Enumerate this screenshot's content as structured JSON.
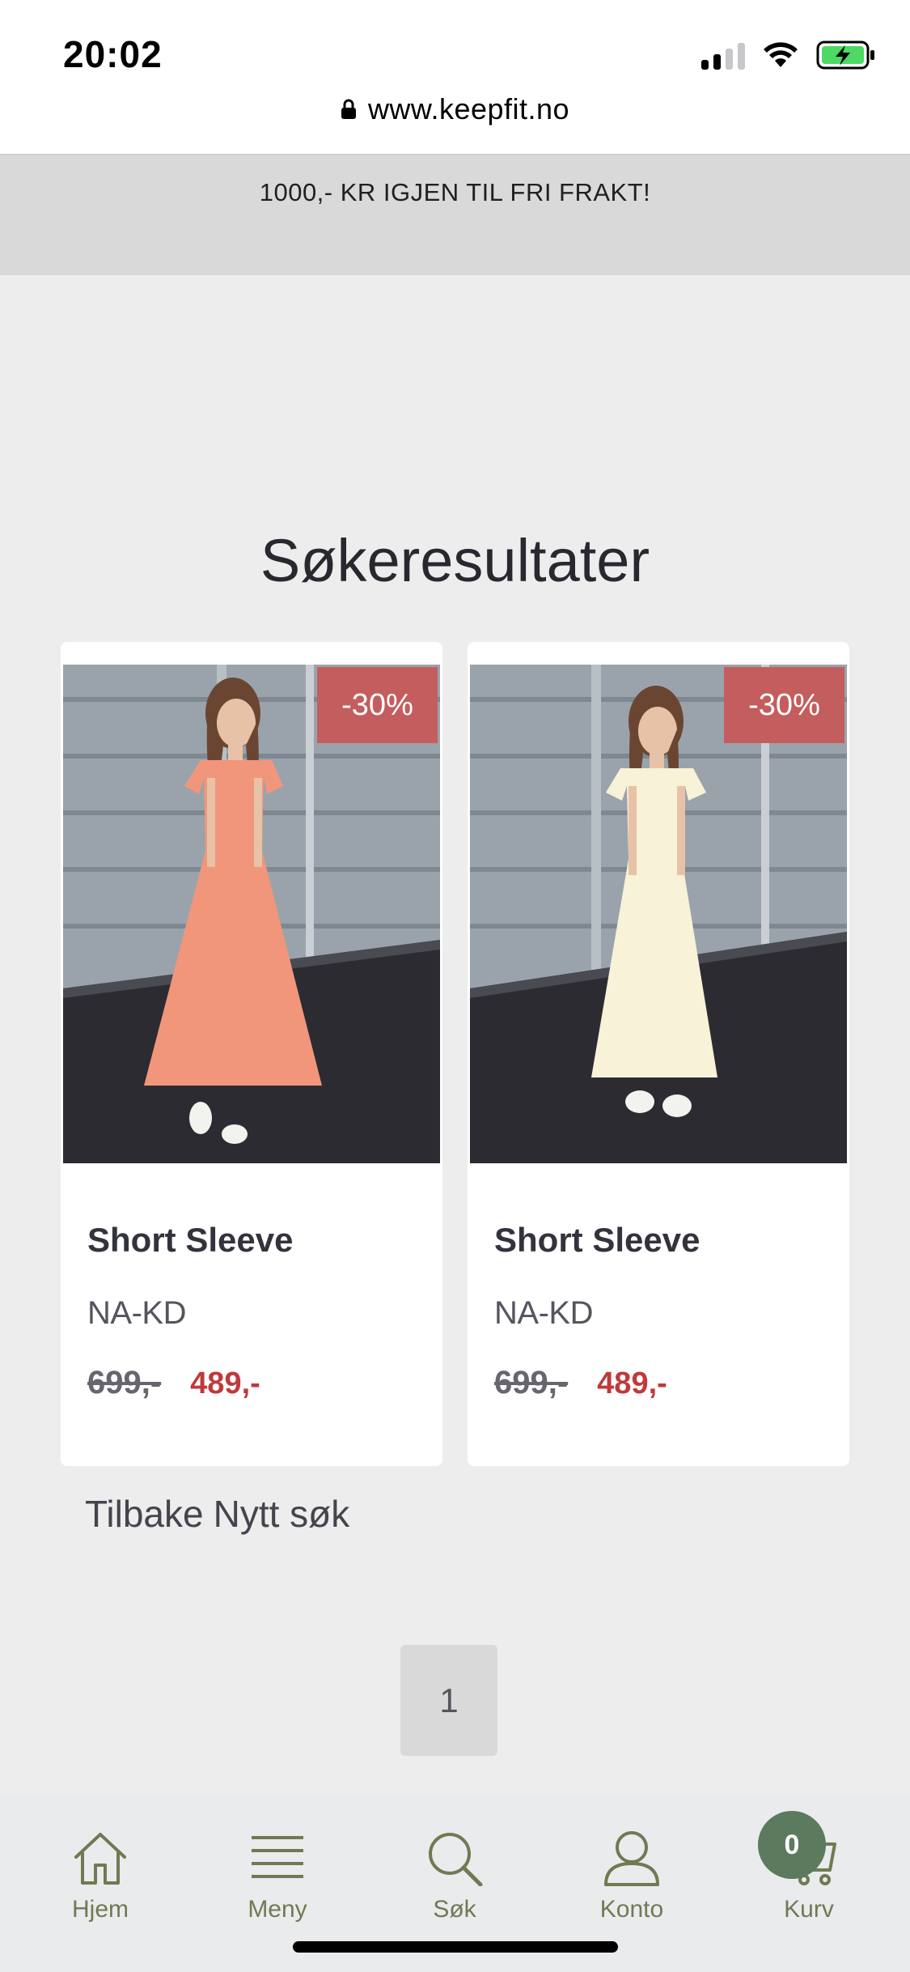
{
  "status_bar": {
    "time": "20:02"
  },
  "browser": {
    "url": "www.keepfit.no"
  },
  "announcement": "1000,- KR IGJEN TIL FRI FRAKT!",
  "page_title": "Søkeresultater",
  "products": [
    {
      "badge": "-30%",
      "title": "Short Sleeve",
      "brand": "NA-KD",
      "old_price": "699,-",
      "new_price": "489,-",
      "dress_color": "#f1967b"
    },
    {
      "badge": "-30%",
      "title": "Short Sleeve",
      "brand": "NA-KD",
      "old_price": "699,-",
      "new_price": "489,-",
      "dress_color": "#f7f2d8"
    }
  ],
  "links": {
    "back": "Tilbake",
    "new_search": "Nytt søk"
  },
  "pagination": {
    "current_page": "1"
  },
  "bottom_nav": {
    "items": [
      {
        "label": "Hjem",
        "icon": "home-icon"
      },
      {
        "label": "Meny",
        "icon": "menu-icon"
      },
      {
        "label": "Søk",
        "icon": "search-icon"
      },
      {
        "label": "Konto",
        "icon": "account-icon"
      },
      {
        "label": "Kurv",
        "icon": "cart-icon"
      }
    ],
    "cart_count": "0"
  },
  "colors": {
    "accent_olive": "#6f7a52",
    "badge_red": "#c45d5d",
    "sale_red": "#c0393b",
    "cart_badge": "#5b7a5e"
  }
}
